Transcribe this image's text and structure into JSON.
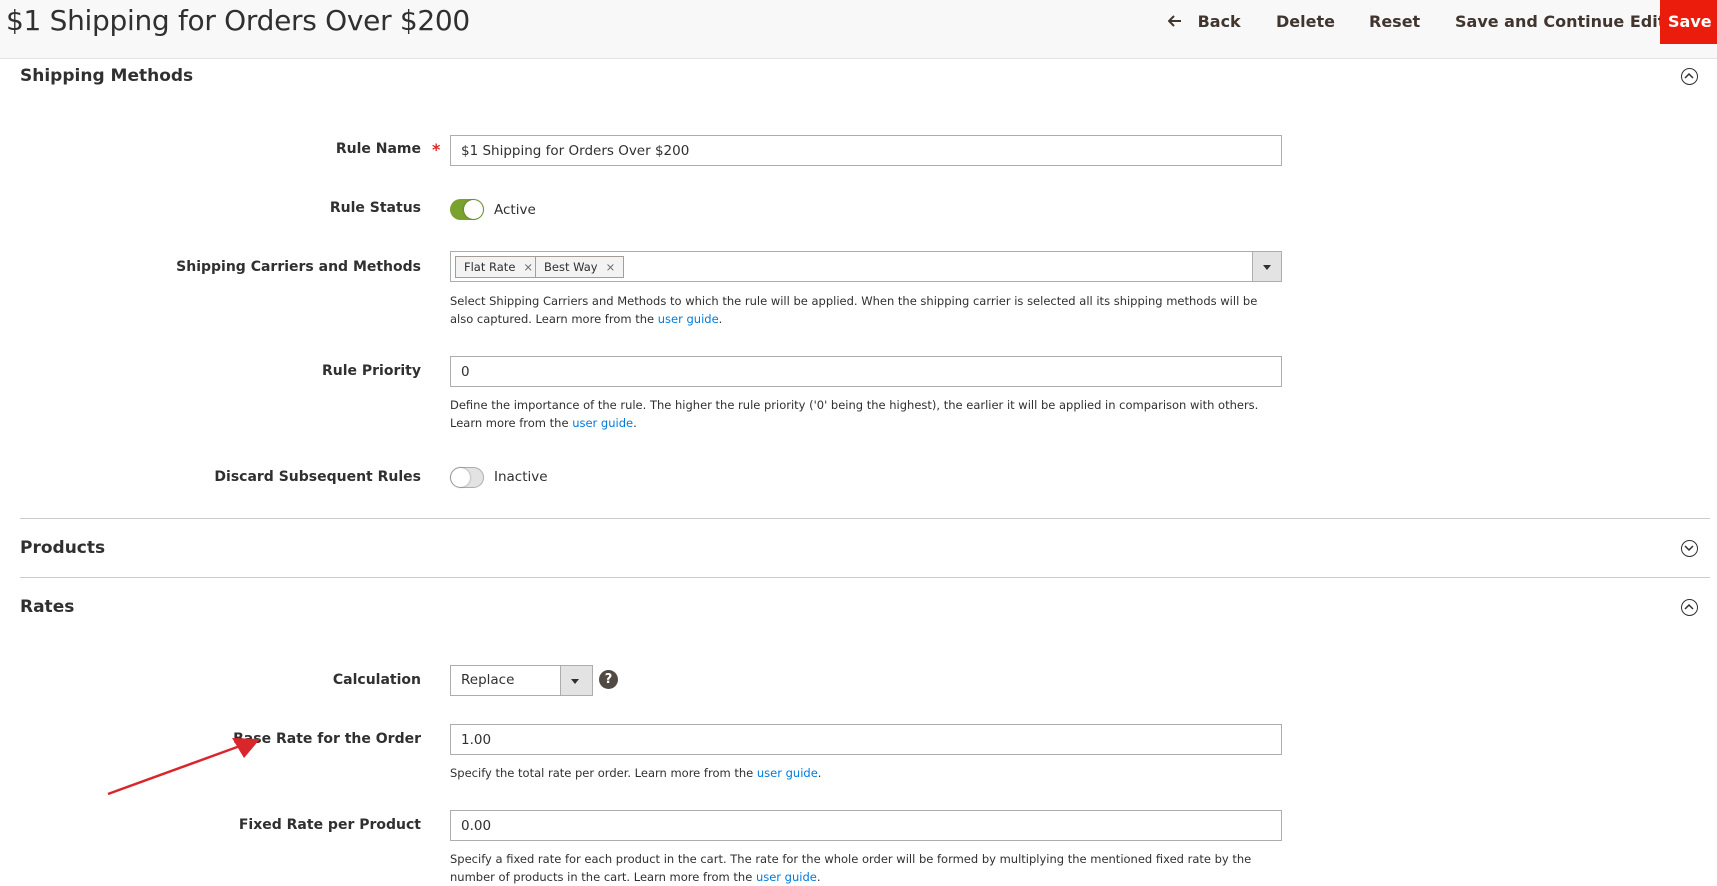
{
  "header": {
    "title": "$1 Shipping for Orders Over $200",
    "back_icon": "arrow-left-icon",
    "back_label": "Back",
    "delete_label": "Delete",
    "reset_label": "Reset",
    "save_continue_label": "Save and Continue Edit",
    "save_label": "Save",
    "save_color": "#eb1c0c"
  },
  "sections": {
    "shipping_methods": {
      "title": "Shipping Methods",
      "icon": "chevron-up-circle-icon"
    },
    "products": {
      "title": "Products",
      "icon": "chevron-down-circle-icon"
    },
    "rates": {
      "title": "Rates",
      "icon": "chevron-up-circle-icon"
    }
  },
  "fields": {
    "rule_name": {
      "label": "Rule Name",
      "required_mark": "*",
      "value": "$1 Shipping for Orders Over $200"
    },
    "rule_status": {
      "label": "Rule Status",
      "state_label": "Active",
      "enabled": true
    },
    "carriers": {
      "label": "Shipping Carriers and Methods",
      "tags": [
        "Flat Rate",
        "Best Way"
      ],
      "remove_glyph": "×",
      "note": "Select Shipping Carriers and Methods to which the rule will be applied. When the shipping carrier is selected all its shipping methods will be also captured. Learn more from the ",
      "link": "user guide",
      "note_end": "."
    },
    "rule_priority": {
      "label": "Rule Priority",
      "value": "0",
      "note": "Define the importance of the rule. The higher the rule priority ('0' being the highest), the earlier it will be applied in comparison with others. Learn more from the ",
      "link": "user guide",
      "note_end": "."
    },
    "discard": {
      "label": "Discard Subsequent Rules",
      "state_label": "Inactive",
      "enabled": false
    },
    "calculation": {
      "label": "Calculation",
      "value": "Replace",
      "help_glyph": "?"
    },
    "base_rate": {
      "label": "Base Rate for the Order",
      "value": "1.00",
      "note": "Specify the total rate per order. Learn more from the ",
      "link": "user guide",
      "note_end": "."
    },
    "fixed_rate": {
      "label": "Fixed Rate per Product",
      "value": "0.00",
      "note": "Specify a fixed rate for each product in the cart. The rate for the whole order will be formed by multiplying the mentioned fixed rate by the number of products in the cart. Learn more from the ",
      "link": "user guide",
      "note_end": "."
    }
  },
  "annotation": {
    "arrow_color": "#d9262b"
  }
}
